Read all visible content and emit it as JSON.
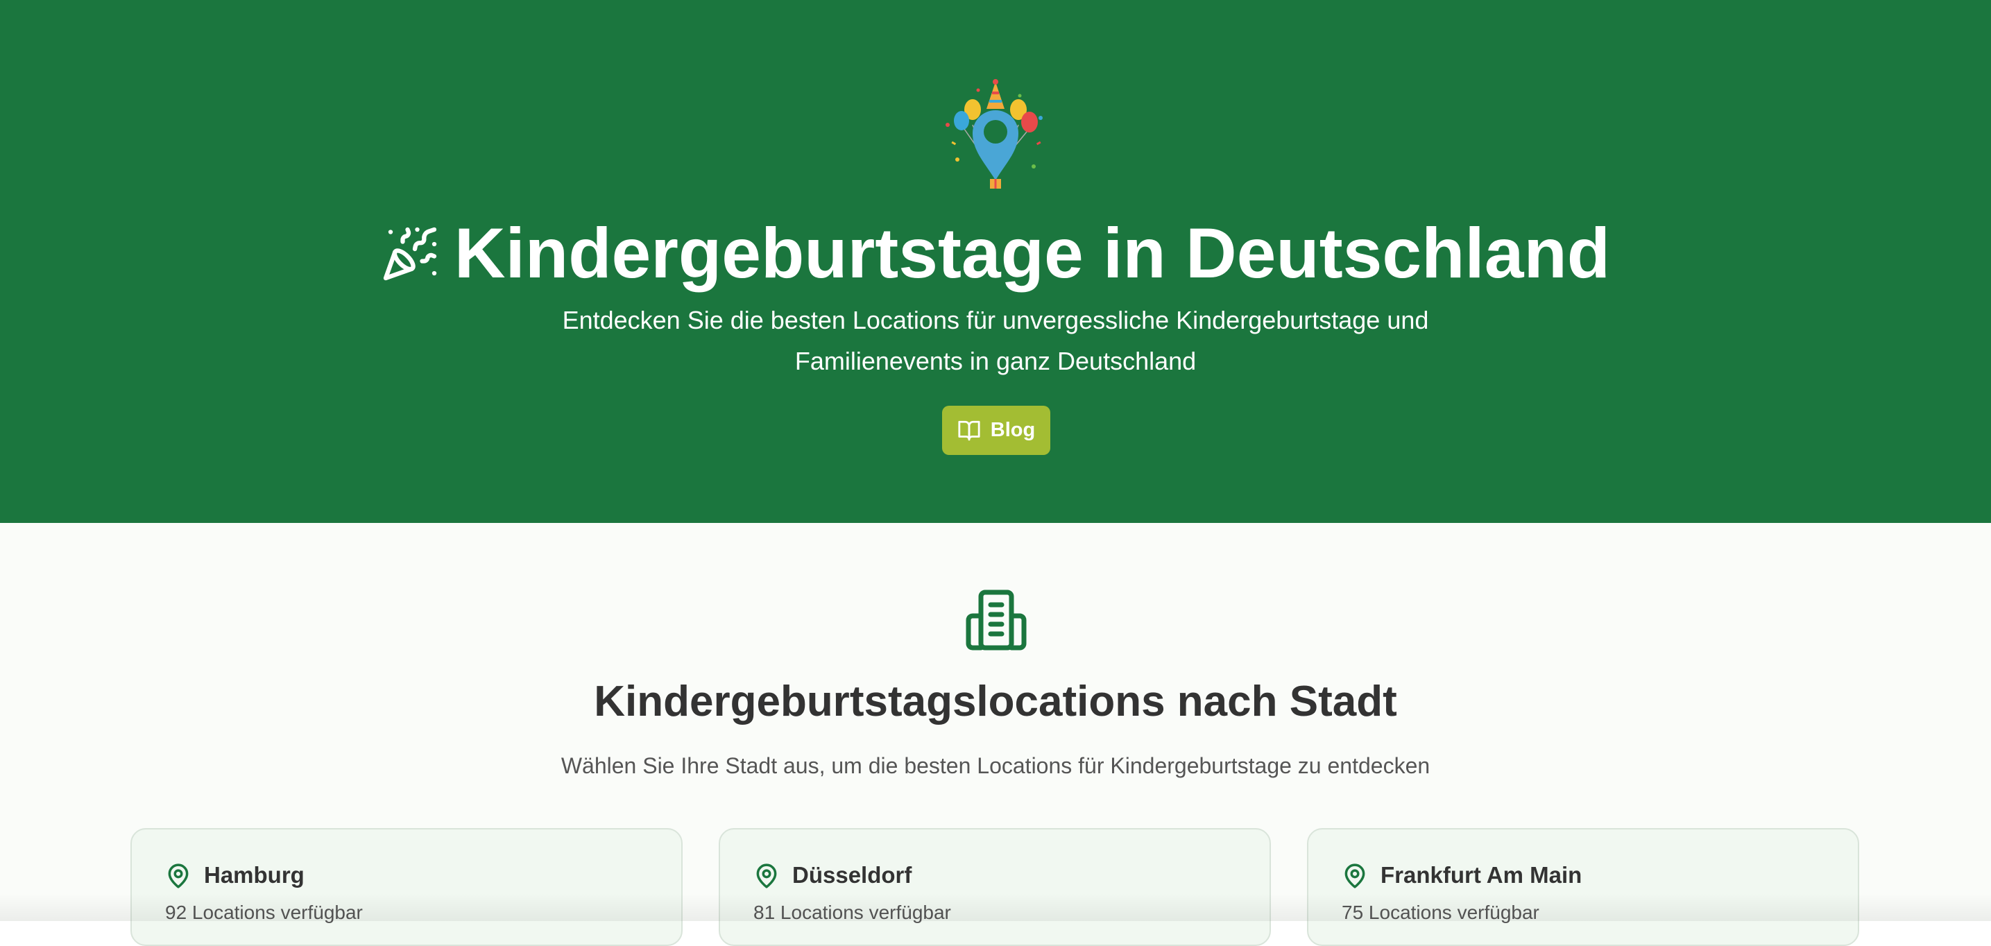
{
  "hero": {
    "title": "Kindergeburtstage in Deutschland",
    "subtitle": "Entdecken Sie die besten Locations für unvergessliche Kindergeburtstage und Familienevents in ganz Deutschland",
    "blog_label": "Blog",
    "background_color": "#1b763e",
    "button_color": "#a3bd33"
  },
  "section": {
    "title": "Kindergeburtstagslocations nach Stadt",
    "subtitle": "Wählen Sie Ihre Stadt aus, um die besten Locations für Kindergeburtstage zu entdecken"
  },
  "cities": [
    {
      "name": "Hamburg",
      "count": "92 Locations verfügbar"
    },
    {
      "name": "Düsseldorf",
      "count": "81 Locations verfügbar"
    },
    {
      "name": "Frankfurt Am Main",
      "count": "75 Locations verfügbar"
    }
  ],
  "icons": {
    "logo": "party-pin-logo",
    "title": "party-popper-icon",
    "blog": "book-open-icon",
    "section": "building-icon",
    "card": "map-pin-icon"
  }
}
